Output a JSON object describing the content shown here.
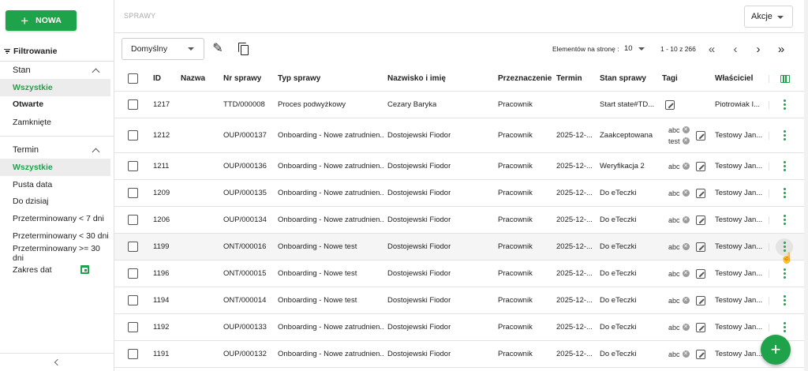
{
  "sidebar": {
    "new_button": "NOWA",
    "filter_title": "Filtrowanie",
    "stan": {
      "title": "Stan",
      "items": [
        "Wszystkie",
        "Otwarte",
        "Zamknięte"
      ]
    },
    "termin": {
      "title": "Termin",
      "items": [
        "Wszystkie",
        "Pusta data",
        "Do dzisiaj",
        "Przeterminowany < 7 dni",
        "Przeterminowany < 30 dni",
        "Przeterminowany >= 30 dni",
        "Zakres dat"
      ]
    }
  },
  "header": {
    "breadcrumb": "SPRAWY",
    "actions_label": "Akcje"
  },
  "toolbar": {
    "view": "Domyślny",
    "per_page_label": "Elementów na stronę :",
    "per_page_value": "10",
    "range": "1 - 10 z 266"
  },
  "table": {
    "columns": [
      "ID",
      "Nazwa",
      "Nr sprawy",
      "Typ sprawy",
      "Nazwisko i imię",
      "Przeznaczenie",
      "Termin",
      "Stan sprawy",
      "Tagi",
      "Właściciel"
    ],
    "rows": [
      {
        "id": "1217",
        "nazwa": "",
        "nr": "TTD/000008",
        "typ": "Proces podwyżkowy",
        "osoba": "Cezary Baryka",
        "przezn": "Pracownik",
        "termin": "",
        "stan": "Start state#TD...",
        "tags": [],
        "wlasc": "Piotrowiak I..."
      },
      {
        "id": "1212",
        "nazwa": "",
        "nr": "OUP/000137",
        "typ": "Onboarding - Nowe zatrudnien...",
        "osoba": "Dostojewski Fiodor",
        "przezn": "Pracownik",
        "termin": "2025-12-...",
        "stan": "Zaakceptowana",
        "tags": [
          "abc",
          "test"
        ],
        "wlasc": "Testowy Jan..."
      },
      {
        "id": "1211",
        "nazwa": "",
        "nr": "OUP/000136",
        "typ": "Onboarding - Nowe zatrudnien...",
        "osoba": "Dostojewski Fiodor",
        "przezn": "Pracownik",
        "termin": "2025-12-...",
        "stan": "Weryfikacja 2",
        "tags": [
          "abc"
        ],
        "wlasc": "Testowy Jan..."
      },
      {
        "id": "1209",
        "nazwa": "",
        "nr": "OUP/000135",
        "typ": "Onboarding - Nowe zatrudnien...",
        "osoba": "Dostojewski Fiodor",
        "przezn": "Pracownik",
        "termin": "2025-12-...",
        "stan": "Do eTeczki",
        "tags": [
          "abc"
        ],
        "wlasc": "Testowy Jan..."
      },
      {
        "id": "1206",
        "nazwa": "",
        "nr": "OUP/000134",
        "typ": "Onboarding - Nowe zatrudnien...",
        "osoba": "Dostojewski Fiodor",
        "przezn": "Pracownik",
        "termin": "2025-12-...",
        "stan": "Do eTeczki",
        "tags": [
          "abc"
        ],
        "wlasc": "Testowy Jan..."
      },
      {
        "id": "1199",
        "nazwa": "",
        "nr": "ONT/000016",
        "typ": "Onboarding - Nowe test",
        "osoba": "Dostojewski Fiodor",
        "przezn": "Pracownik",
        "termin": "2025-12-...",
        "stan": "Do eTeczki",
        "tags": [
          "abc"
        ],
        "wlasc": "Testowy Jan..."
      },
      {
        "id": "1196",
        "nazwa": "",
        "nr": "ONT/000015",
        "typ": "Onboarding - Nowe test",
        "osoba": "Dostojewski Fiodor",
        "przezn": "Pracownik",
        "termin": "2025-12-...",
        "stan": "Do eTeczki",
        "tags": [
          "abc"
        ],
        "wlasc": "Testowy Jan..."
      },
      {
        "id": "1194",
        "nazwa": "",
        "nr": "ONT/000014",
        "typ": "Onboarding - Nowe test",
        "osoba": "Dostojewski Fiodor",
        "przezn": "Pracownik",
        "termin": "2025-12-...",
        "stan": "Do eTeczki",
        "tags": [
          "abc"
        ],
        "wlasc": "Testowy Jan..."
      },
      {
        "id": "1192",
        "nazwa": "",
        "nr": "OUP/000133",
        "typ": "Onboarding - Nowe zatrudnien...",
        "osoba": "Dostojewski Fiodor",
        "przezn": "Pracownik",
        "termin": "2025-12-...",
        "stan": "Do eTeczki",
        "tags": [
          "abc"
        ],
        "wlasc": "Testowy Jan..."
      },
      {
        "id": "1191",
        "nazwa": "",
        "nr": "OUP/000132",
        "typ": "Onboarding - Nowe zatrudnien...",
        "osoba": "Dostojewski Fiodor",
        "przezn": "Pracownik",
        "termin": "2025-12-...",
        "stan": "Do eTeczki",
        "tags": [
          "abc"
        ],
        "wlasc": "Testowy Jan..."
      }
    ]
  },
  "colors": {
    "accent": "#1fa34a"
  }
}
